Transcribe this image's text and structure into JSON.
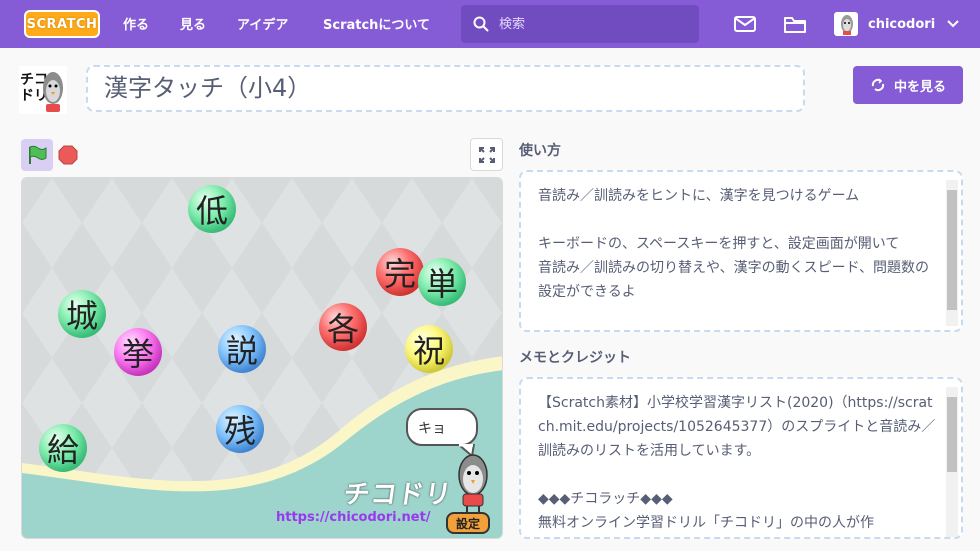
{
  "nav": {
    "logo": "SCRATCH",
    "links": [
      "作る",
      "見る",
      "アイデア",
      "Scratchについて"
    ],
    "search_placeholder": "検索",
    "username": "chicodori"
  },
  "project": {
    "title": "漢字タッチ（小4）",
    "see_inside": "中を見る"
  },
  "stage": {
    "kanji": [
      {
        "char": "低",
        "color": "green"
      },
      {
        "char": "完",
        "color": "red"
      },
      {
        "char": "単",
        "color": "green"
      },
      {
        "char": "城",
        "color": "green"
      },
      {
        "char": "各",
        "color": "red"
      },
      {
        "char": "祝",
        "color": "yellow"
      },
      {
        "char": "挙",
        "color": "pink"
      },
      {
        "char": "説",
        "color": "blue"
      },
      {
        "char": "残",
        "color": "blue"
      },
      {
        "char": "給",
        "color": "green"
      }
    ],
    "bubble_text": "キョ",
    "brand": "チコドリ",
    "url": "https://chicodori.net/",
    "settings_label": "設定"
  },
  "instructions": {
    "heading": "使い方",
    "text": "音読み／訓読みをヒントに、漢字を見つけるゲーム\n\nキーボードの、スペースキーを押すと、設定画面が開いて\n音読み／訓読みの切り替えや、漢字の動くスピード、問題数の設定ができるよ"
  },
  "notes": {
    "heading": "メモとクレジット",
    "text": "【Scratch素材】小学校学習漢字リスト(2020)（https://scratch.mit.edu/projects/1052645377）のスプライトと音読み／訓読みのリストを活用しています。\n\n◆◆◆チコラッチ◆◆◆\n無料オンライン学習ドリル「チコドリ」の中の人が作"
  }
}
